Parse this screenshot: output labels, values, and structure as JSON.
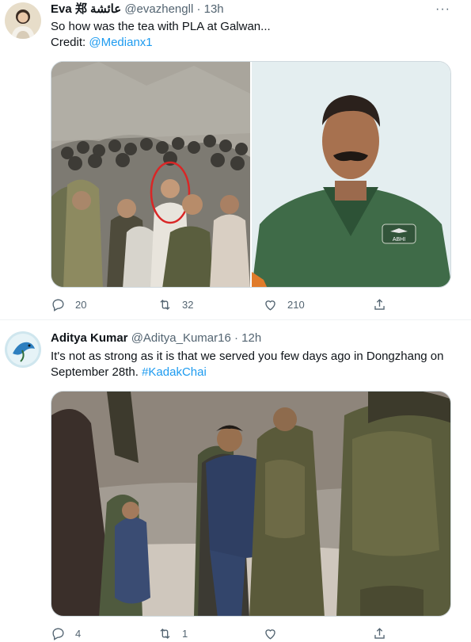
{
  "tweets": [
    {
      "author": {
        "name": "Eva 郑 عائشة",
        "handle": "@evazhengll",
        "avatar_icon": "avatar-woman-icon"
      },
      "time": "13h",
      "text": "So how was the tea with PLA at Galwan...",
      "credit_label": "Credit: ",
      "credit_link": "@Medianx1",
      "media": [
        {
          "icon": "soldiers-crowd-photo",
          "description_hidden": true
        },
        {
          "icon": "pilot-portrait-photo",
          "badge_text": "ABHI"
        }
      ],
      "actions": {
        "replies": "20",
        "retweets": "32",
        "likes": "210"
      }
    },
    {
      "author": {
        "name": "Aditya Kumar",
        "handle": "@Aditya_Kumar16",
        "avatar_icon": "avatar-bird-icon"
      },
      "time": "12h",
      "text": "It's not as strong as it is that we served you few days ago in Dongzhang on September 28th. ",
      "hashtag": "#KadakChai",
      "media": [
        {
          "icon": "soldiers-detaining-photo"
        }
      ],
      "actions": {
        "replies": "4",
        "retweets": "1",
        "likes": "",
        "share": ""
      }
    }
  ],
  "ui": {
    "separator_dot": "·",
    "more_glyph": "···"
  },
  "colors": {
    "link": "#1d9bf0",
    "muted": "#536471",
    "border": "#eff3f4"
  }
}
